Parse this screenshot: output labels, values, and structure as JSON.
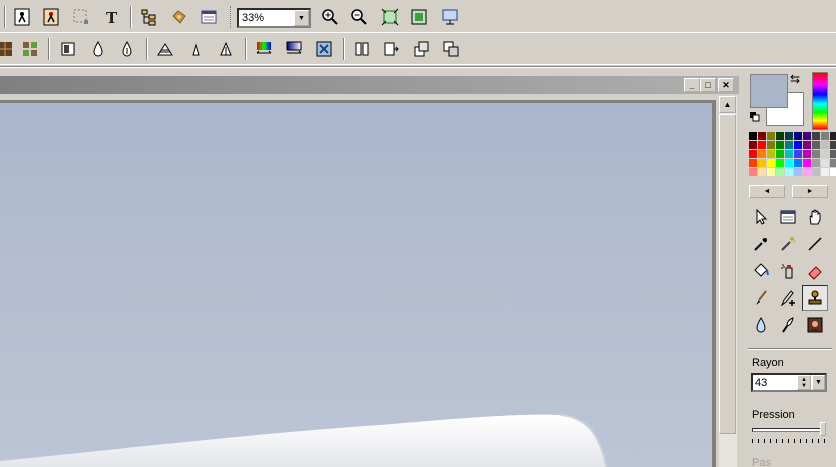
{
  "toolbar1": {
    "zoom_value": "33%",
    "buttons": [
      "open-icon",
      "browse-icon",
      "selection-icon",
      "text-tool-icon",
      "hierarchy-icon",
      "plugin-icon",
      "window-icon",
      "zoom-in-icon",
      "zoom-out-icon",
      "fit-icon",
      "actual-size-icon",
      "slideshow-icon"
    ]
  },
  "toolbar2": {
    "buttons": [
      "grid-icon",
      "mosaic-icon",
      "frame-icon",
      "blur-icon",
      "sharpen-icon",
      "triangle-filter-icon",
      "small-triangle-icon",
      "outline-triangle-icon",
      "color-balance-icon",
      "gradient-icon",
      "effect-icon",
      "flip-horizontal-icon",
      "flip-vertical-icon",
      "rotate-icon",
      "transform-icon"
    ]
  },
  "document": {
    "minimize": "_",
    "maximize": "□",
    "close": "✕"
  },
  "colors": {
    "foreground": "#a9b5c9",
    "background": "#ffffff",
    "palette": [
      "#000000",
      "#800000",
      "#808000",
      "#004000",
      "#004040",
      "#000080",
      "#400080",
      "#404040",
      "#808080",
      "#202020",
      "#800000",
      "#ff0000",
      "#808000",
      "#008000",
      "#008080",
      "#0000ff",
      "#800080",
      "#606060",
      "#c0c0c0",
      "#404040",
      "#ff0000",
      "#ff8000",
      "#c0c000",
      "#00c000",
      "#00c0c0",
      "#4040ff",
      "#c000c0",
      "#808080",
      "#d0d0d0",
      "#606060",
      "#ff4000",
      "#ffc000",
      "#ffff00",
      "#00ff00",
      "#00ffff",
      "#0080ff",
      "#ff00ff",
      "#a0a0a0",
      "#e0e0e0",
      "#808080",
      "#ff8080",
      "#ffe0a0",
      "#ffffa0",
      "#a0ffa0",
      "#a0ffff",
      "#a0c0ff",
      "#ffa0ff",
      "#c0c0c0",
      "#f0f0f0",
      "#ffffff"
    ]
  },
  "tools": [
    "pointer-icon",
    "browser-icon",
    "hand-icon",
    "eyedropper-icon",
    "magic-wand-icon",
    "line-icon",
    "paint-bucket-icon",
    "spray-icon",
    "eraser-icon",
    "brush-icon",
    "pen-plus-icon",
    "clone-stamp-icon",
    "water-drop-icon",
    "smudge-icon",
    "photo-icon"
  ],
  "props": {
    "radius_label": "Rayon",
    "radius_value": "43",
    "pressure_label": "Pression",
    "pas_label": "Pas"
  }
}
